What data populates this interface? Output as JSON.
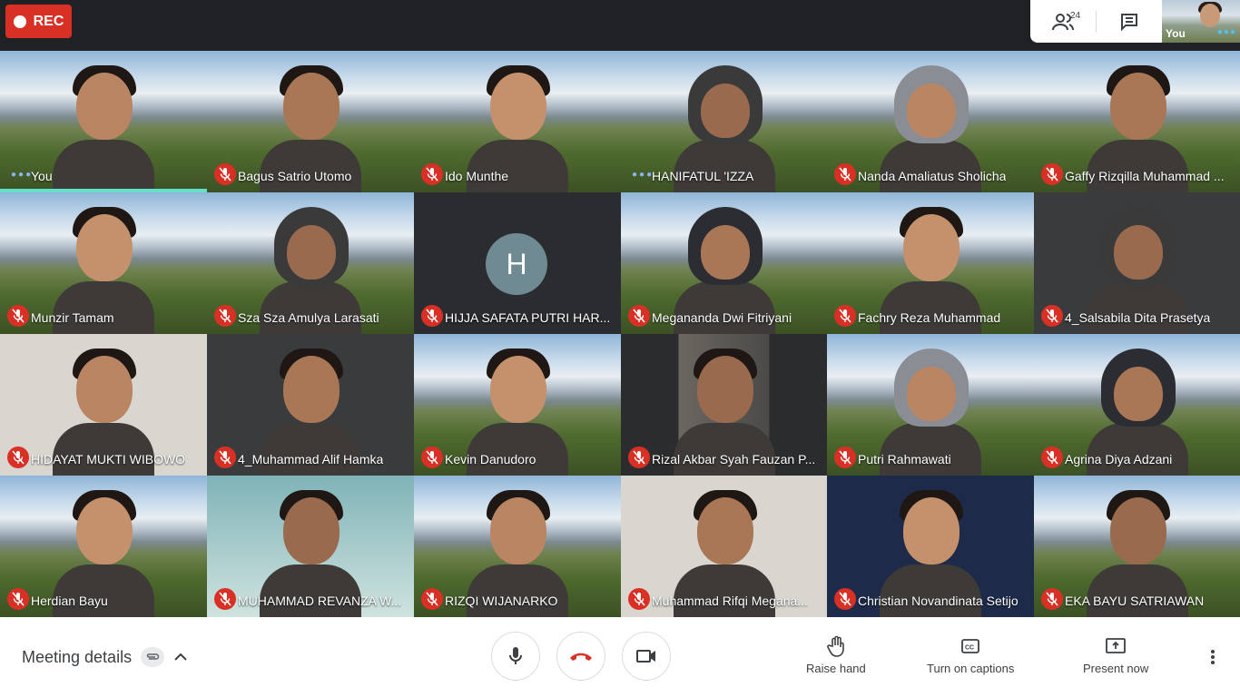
{
  "recording": {
    "label": "REC",
    "color": "#d93025"
  },
  "top_panel": {
    "participants_count": "24",
    "self_label": "You"
  },
  "participants": [
    {
      "name": "You",
      "state": "speaking",
      "bg": "scene",
      "person": "plain"
    },
    {
      "name": "Bagus Satrio Utomo",
      "state": "muted",
      "bg": "scene",
      "person": "plain"
    },
    {
      "name": "Ido Munthe",
      "state": "muted",
      "bg": "scene",
      "person": "plain"
    },
    {
      "name": "HANIFATUL 'IZZA",
      "state": "speaking",
      "bg": "scene",
      "person": "hijab"
    },
    {
      "name": "Nanda Amaliatus Sholicha",
      "state": "muted",
      "bg": "scene",
      "person": "hijab"
    },
    {
      "name": "Gaffy Rizqilla Muhammad ...",
      "state": "muted",
      "bg": "scene",
      "person": "plain"
    },
    {
      "name": "Munzir Tamam",
      "state": "muted",
      "bg": "scene",
      "person": "plain"
    },
    {
      "name": "Sza Sza Amulya Larasati",
      "state": "muted",
      "bg": "scene",
      "person": "hijab"
    },
    {
      "name": "HIJJA SAFATA PUTRI HAR...",
      "state": "muted",
      "bg": "blank",
      "avatar": "H"
    },
    {
      "name": "Megananda Dwi Fitriyani",
      "state": "muted",
      "bg": "scene",
      "person": "hijab"
    },
    {
      "name": "Fachry Reza Muhammad",
      "state": "muted",
      "bg": "scene",
      "person": "plain"
    },
    {
      "name": "4_Salsabila Dita Prasetya",
      "state": "muted",
      "bg": "dark",
      "person": "hijab"
    },
    {
      "name": "HIDAYAT MUKTI WIBOWO",
      "state": "muted",
      "bg": "light",
      "person": "plain"
    },
    {
      "name": "4_Muhammad Alif Hamka",
      "state": "muted",
      "bg": "dark",
      "person": "plain"
    },
    {
      "name": "Kevin Danudoro",
      "state": "muted",
      "bg": "scene",
      "person": "plain"
    },
    {
      "name": "Rizal Akbar Syah Fauzan P...",
      "state": "muted",
      "bg": "room",
      "person": "plain"
    },
    {
      "name": "Putri Rahmawati",
      "state": "muted",
      "bg": "scene",
      "person": "hijab"
    },
    {
      "name": "Agrina Diya Adzani",
      "state": "muted",
      "bg": "scene",
      "person": "hijab"
    },
    {
      "name": "Herdian Bayu",
      "state": "muted",
      "bg": "scene",
      "person": "plain"
    },
    {
      "name": "MUHAMMAD REVANZA W...",
      "state": "muted",
      "bg": "teal",
      "person": "plain"
    },
    {
      "name": "RIZQI WIJANARKO",
      "state": "muted",
      "bg": "scene",
      "person": "plain"
    },
    {
      "name": "Muhammad Rifqi Megana...",
      "state": "muted",
      "bg": "light",
      "person": "plain"
    },
    {
      "name": "Christian Novandinata Setijo",
      "state": "muted",
      "bg": "navy",
      "person": "plain"
    },
    {
      "name": "EKA BAYU SATRIAWAN",
      "state": "muted",
      "bg": "scene",
      "person": "plain"
    }
  ],
  "bottom_bar": {
    "meeting_details": "Meeting details",
    "raise_hand": "Raise hand",
    "captions": "Turn on captions",
    "present": "Present now"
  }
}
